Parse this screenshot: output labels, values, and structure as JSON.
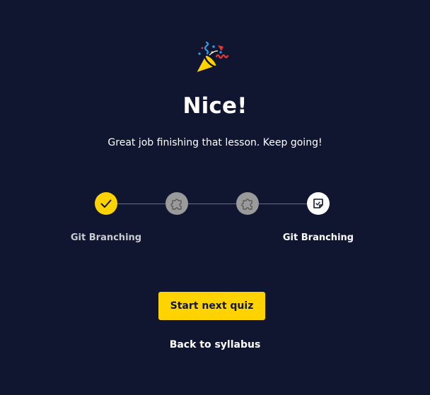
{
  "celebration": {
    "icon": "party-popper-icon",
    "headline": "Nice!",
    "message": "Great job finishing that lesson. Keep going!"
  },
  "progress": {
    "steps": [
      {
        "status": "completed",
        "icon": "checkmark-icon",
        "label": "Git Branching"
      },
      {
        "status": "locked",
        "icon": "puzzle-piece-icon",
        "label": ""
      },
      {
        "status": "locked",
        "icon": "puzzle-piece-icon",
        "label": ""
      },
      {
        "status": "current",
        "icon": "quiz-note-icon",
        "label": "Git Branching"
      }
    ]
  },
  "actions": {
    "primary_label": "Start next quiz",
    "secondary_label": "Back to syllabus"
  },
  "colors": {
    "background": "#10162f",
    "accent": "#ffd300",
    "locked": "#9a9a9a",
    "text": "#ffffff"
  }
}
